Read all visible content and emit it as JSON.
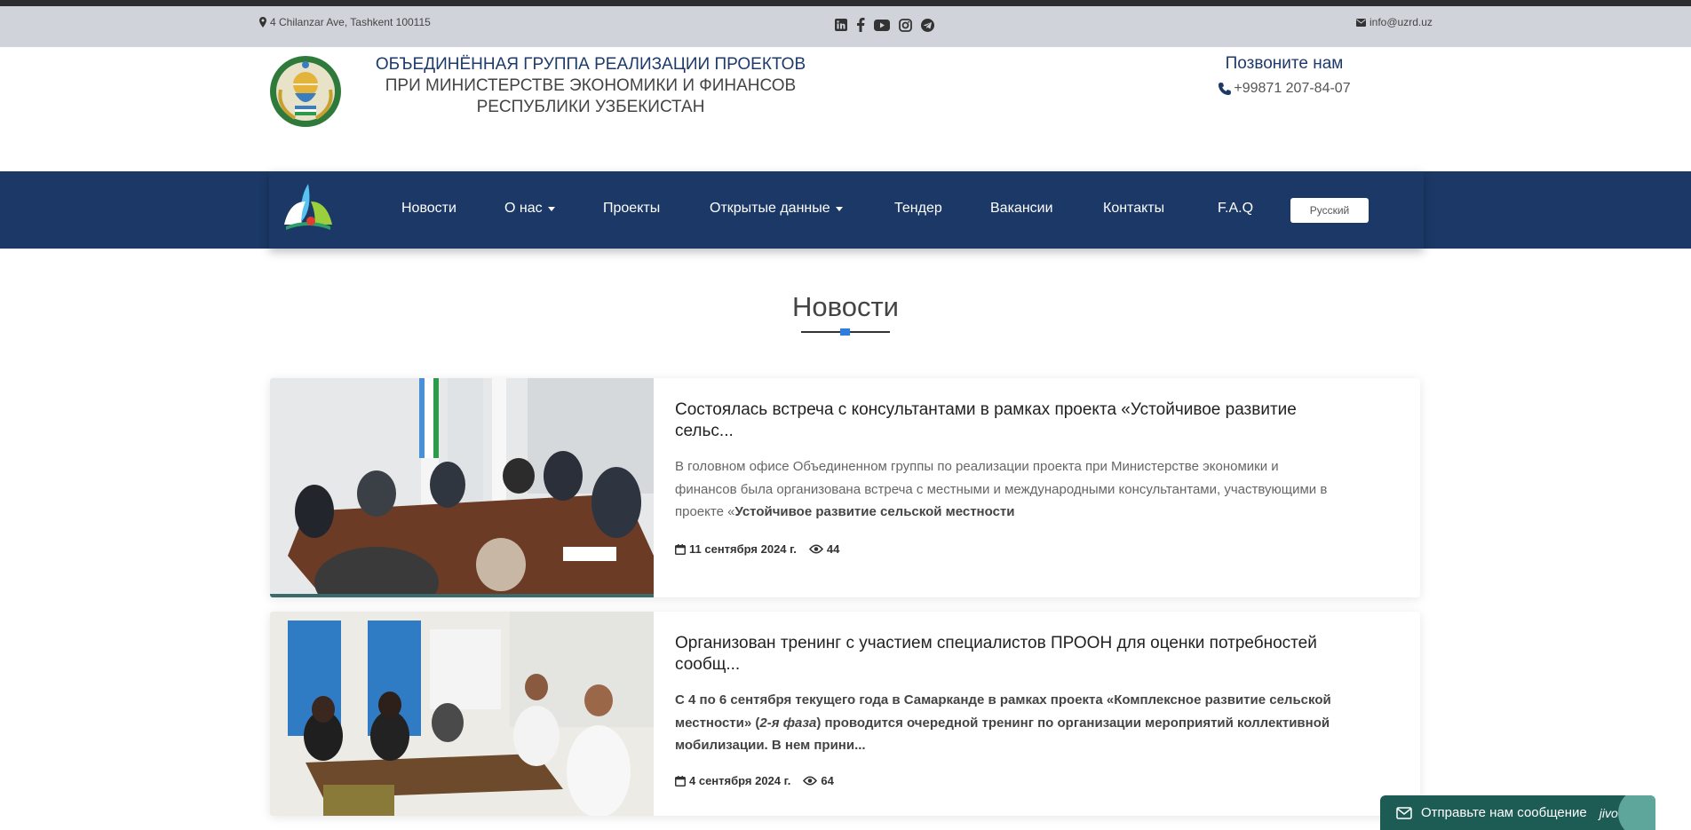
{
  "topbar": {
    "address": "4 Chilanzar Ave, Tashkent 100115",
    "email": "info@uzrd.uz",
    "social_icons": [
      "linkedin-icon",
      "facebook-icon",
      "youtube-icon",
      "instagram-icon",
      "telegram-icon"
    ]
  },
  "header": {
    "org_line1": "ОБЪЕДИНЁННАЯ ГРУППА РЕАЛИЗАЦИИ ПРОЕКТОВ",
    "org_line2": "ПРИ МИНИСТЕРСТВЕ ЭКОНОМИКИ И ФИНАНСОВ",
    "org_line3": "РЕСПУБЛИКИ УЗБЕКИСТАН",
    "call_title": "Позвоните нам",
    "phone": "+99871 207-84-07"
  },
  "nav": {
    "items": [
      {
        "label": "Новости"
      },
      {
        "label": "О нас"
      },
      {
        "label": "Проекты"
      },
      {
        "label": "Открытые данные"
      },
      {
        "label": "Тендер"
      },
      {
        "label": "Вакансии"
      },
      {
        "label": "Контакты"
      },
      {
        "label": "F.A.Q"
      }
    ],
    "language": "Русский"
  },
  "main": {
    "section_title": "Новости",
    "news": [
      {
        "title_line1": "Состоялась встреча с консультантами в рамках проекта «Устойчивое развитие",
        "title_line2": "сельс...",
        "text_line1": "В головном офисе Объединенном группы по реализации проекта при Министерстве экономики и",
        "text_line2": "финансов была организована встреча с местными и международными консультантами, участвующими в",
        "text_line3_plain": "проекте «",
        "text_line3_bold": "Устойчивое развитие сельской местности",
        "date": "11 сентября 2024 г.",
        "views": "44"
      },
      {
        "title_line1": "Организован тренинг с участием специалистов ПРООН для оценки потребностей",
        "title_line2": "сообщ...",
        "text_line1": "С 4 по 6 сентября текущего года в Самарканде в рамках проекта «Комплексное развитие сельской",
        "text_line2_a": "местности» (",
        "text_line2_i": "2-я фаза",
        "text_line2_b": ") проводится очередной тренинг по организации мероприятий коллективной",
        "text_line3": "мобилизации. В нем прини...",
        "date": "4 сентября 2024 г.",
        "views": "64"
      }
    ]
  },
  "chat": {
    "label": "Отправьте нам сообщение",
    "brand": "jivo"
  },
  "colors": {
    "navy": "#1b3866",
    "topbar": "#d0d4da",
    "accent_blue": "#2f7de1",
    "chat_green": "#1d5c55"
  }
}
